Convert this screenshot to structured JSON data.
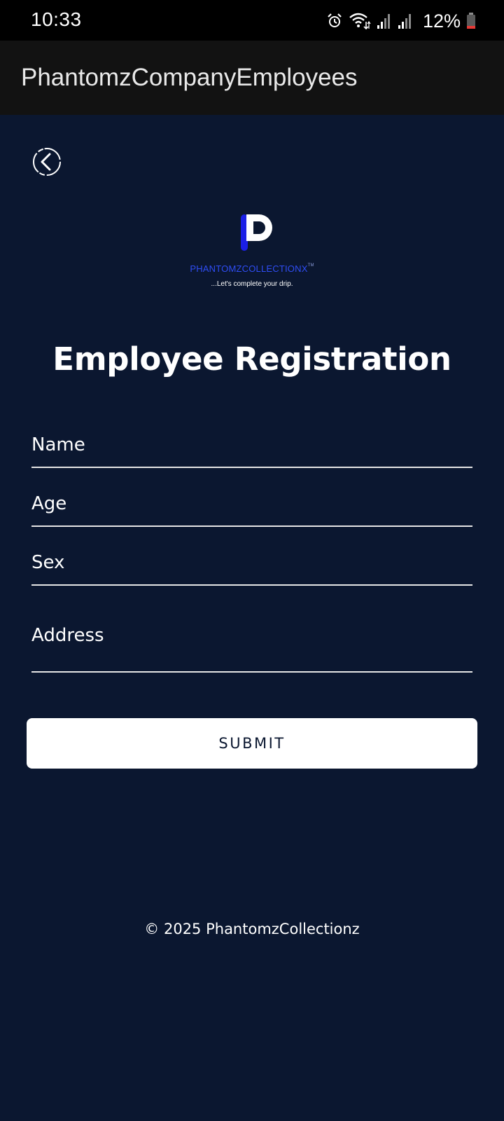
{
  "status_bar": {
    "time": "10:33",
    "battery_percent": "12%",
    "icons": [
      "alarm-icon",
      "wifi-icon",
      "signal-icon",
      "signal-icon",
      "battery-icon"
    ],
    "battery_level": 0.12,
    "battery_low_color": "#e53935"
  },
  "app_bar": {
    "title": "PhantomzCompanyEmployees"
  },
  "back_button": {
    "icon": "chevron-left-icon"
  },
  "logo": {
    "brand": "PHANTOMZCOLLECTIONX",
    "trademark": "TM",
    "tagline": "...Let's complete your drip.",
    "accent_color": "#1b1fe6"
  },
  "form": {
    "title": "Employee Registration",
    "fields": {
      "name": {
        "placeholder": "Name",
        "value": ""
      },
      "age": {
        "placeholder": "Age",
        "value": ""
      },
      "sex": {
        "placeholder": "Sex",
        "value": ""
      },
      "address": {
        "placeholder": "Address",
        "value": ""
      }
    },
    "submit_label": "SUBMIT"
  },
  "footer": {
    "text": "© 2025 PhantomzCollectionz"
  },
  "colors": {
    "background": "#0b1730",
    "app_bar": "#121212",
    "status_bar": "#000000",
    "button_bg": "#ffffff",
    "button_text": "#0b1730"
  }
}
